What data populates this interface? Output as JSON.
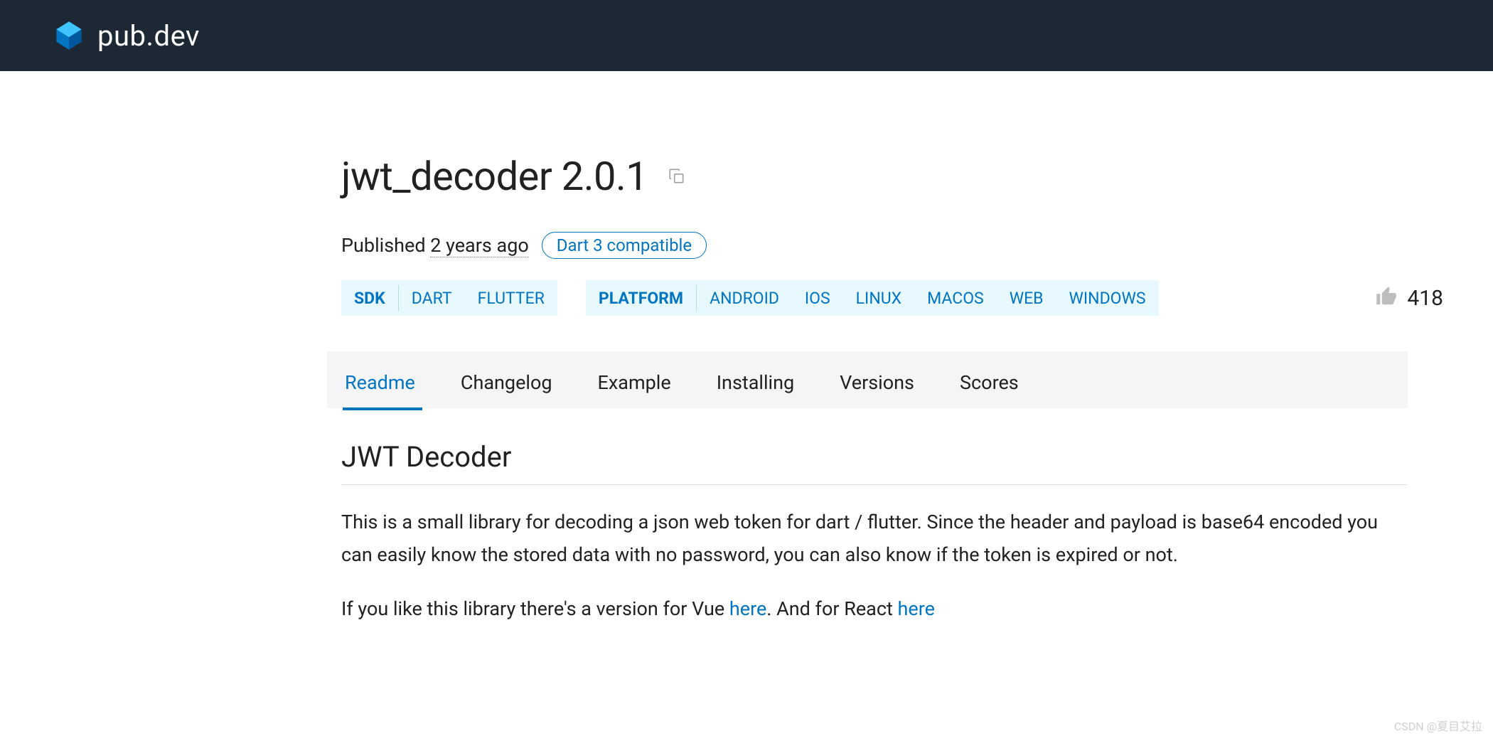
{
  "header": {
    "site_name": "pub.dev"
  },
  "package": {
    "title": "jwt_decoder 2.0.1",
    "published_prefix": "Published ",
    "published_time": "2 years ago",
    "compatibility_badge": "Dart 3 compatible"
  },
  "tags": {
    "sdk": {
      "label": "SDK",
      "items": [
        "DART",
        "FLUTTER"
      ]
    },
    "platform": {
      "label": "PLATFORM",
      "items": [
        "ANDROID",
        "IOS",
        "LINUX",
        "MACOS",
        "WEB",
        "WINDOWS"
      ]
    }
  },
  "likes": {
    "count": "418"
  },
  "tabs": [
    "Readme",
    "Changelog",
    "Example",
    "Installing",
    "Versions",
    "Scores"
  ],
  "readme": {
    "heading": "JWT Decoder",
    "paragraph1": "This is a small library for decoding a json web token for dart / flutter. Since the header and payload is base64 encoded you can easily know the stored data with no password, you can also know if the token is expired or not.",
    "paragraph2_part1": "If you like this library there's a version for Vue ",
    "paragraph2_link1": "here",
    "paragraph2_part2": ". And for React ",
    "paragraph2_link2": "here"
  },
  "watermark": "CSDN @夏目艾拉"
}
